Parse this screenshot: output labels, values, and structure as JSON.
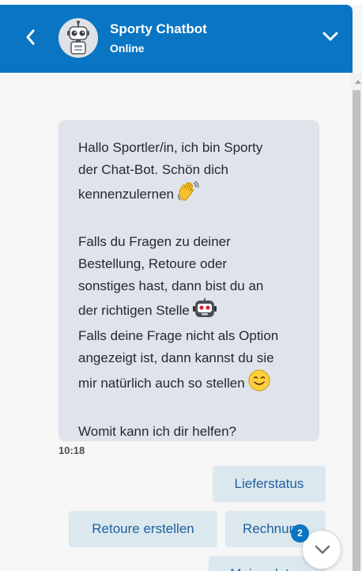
{
  "header": {
    "title": "Sporty Chatbot",
    "status": "Online"
  },
  "icons": {
    "back": "chevron-left-icon",
    "collapse": "chevron-down-icon",
    "avatar": "robot-avatar",
    "wave": "waving-hand-emoji",
    "robot": "robot-emoji",
    "smile": "smiling-face-emoji",
    "scroll_down": "chevron-down-icon"
  },
  "colors": {
    "header_bg": "#0a75c2",
    "bubble_bg": "#dfe3ea",
    "reply_bg": "#dbe8ee",
    "reply_text": "#1f5fa0",
    "badge_bg": "#0a75c2"
  },
  "message": {
    "p1_lines": [
      "Hallo Sportler/in, ich bin Sporty",
      "der Chat-Bot. Schön dich",
      "kennenzulernen"
    ],
    "p2_lines": [
      "Falls du Fragen zu deiner",
      "Bestellung, Retoure oder",
      "sonstiges hast, dann bist du an",
      "der richtigen Stelle",
      "Falls deine Frage nicht als Option",
      "angezeigt ist, dann kannst du sie",
      "mir natürlich auch so stellen"
    ],
    "p3": "Womit kann ich dir helfen?",
    "time": "10:18"
  },
  "quick_replies": [
    "Lieferstatus",
    "Retoure erstellen",
    "Rechnung",
    "Meine daten"
  ],
  "scroll_badge": "2"
}
